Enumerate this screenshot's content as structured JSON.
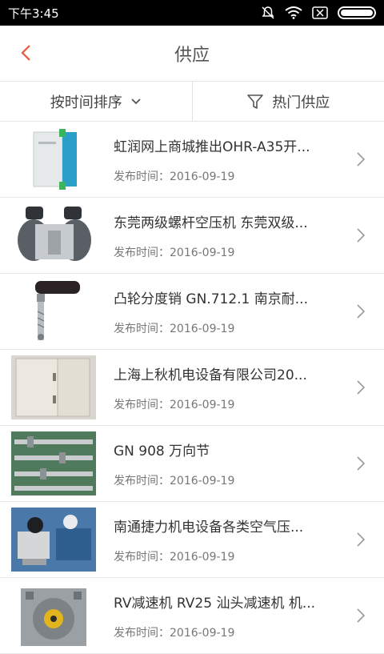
{
  "status": {
    "time": "下午3:45"
  },
  "header": {
    "title": "供应"
  },
  "filters": {
    "sort_label": "按时间排序",
    "hot_label": "热门供应"
  },
  "items": [
    {
      "title": "虹润网上商城推出OHR-A35开...",
      "date_prefix": "发布时间：",
      "date": "2016-09-19",
      "thumb": "din-rail-module"
    },
    {
      "title": "东莞两级螺杆空压机  东莞双级...",
      "date_prefix": "发布时间：",
      "date": "2016-09-19",
      "thumb": "air-compressor"
    },
    {
      "title": "凸轮分度销    GN.712.1   南京耐...",
      "date_prefix": "发布时间：",
      "date": "2016-09-19",
      "thumb": "indexing-plunger"
    },
    {
      "title": "上海上秋机电设备有限公司20...",
      "date_prefix": "发布时间：",
      "date": "2016-09-19",
      "thumb": "oven-cabinet"
    },
    {
      "title": "GN 908 万向节",
      "date_prefix": "发布时间：",
      "date": "2016-09-19",
      "thumb": "universal-joints"
    },
    {
      "title": "南通捷力机电设备各类空气压...",
      "date_prefix": "发布时间：",
      "date": "2016-09-19",
      "thumb": "compressor-pumps"
    },
    {
      "title": "RV减速机 RV25 汕头减速机 机...",
      "date_prefix": "发布时间：",
      "date": "2016-09-19",
      "thumb": "worm-gear-reducer"
    }
  ],
  "colors": {
    "accent": "#e8583a",
    "statusbar": "#000000"
  }
}
